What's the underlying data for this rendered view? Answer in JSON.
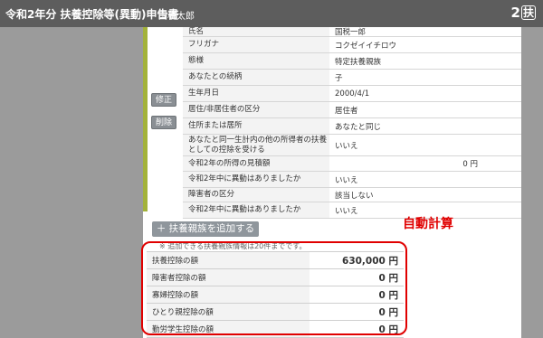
{
  "header": {
    "title": "令和2年分 扶養控除等(異動)申告書",
    "user": "国税太郎",
    "form_no": "2",
    "form_kanji": "扶"
  },
  "side_buttons": {
    "edit": "修正",
    "delete": "削除"
  },
  "details": [
    {
      "label": "氏名",
      "value": "国税一郎"
    },
    {
      "label": "フリガナ",
      "value": "コクゼイイチロウ"
    },
    {
      "label": "態様",
      "value": "特定扶養親族"
    },
    {
      "label": "あなたとの続柄",
      "value": "子"
    },
    {
      "label": "生年月日",
      "value": "2000/4/1"
    },
    {
      "label": "居住/非居住者の区分",
      "value": "居住者"
    },
    {
      "label": "住所または居所",
      "value": "あなたと同じ"
    },
    {
      "label": "あなたと同一生計内の他の所得者の扶養としての控除を受ける",
      "value": "いいえ"
    },
    {
      "label": "令和2年の所得の見積額",
      "value": "0 円"
    },
    {
      "label": "令和2年中に異動はありましたか",
      "value": "いいえ"
    },
    {
      "label": "障害者の区分",
      "value": "該当しない"
    },
    {
      "label": "令和2年中に異動はありましたか",
      "value": "いいえ"
    }
  ],
  "add_button": "＋ 扶養親族を追加する",
  "auto_calc": "自動計算",
  "note": "※ 追加できる扶養親族情報は20件までです。",
  "deductions": [
    {
      "label": "扶養控除の額",
      "value": "630,000 円"
    },
    {
      "label": "障害者控除の額",
      "value": "0 円"
    },
    {
      "label": "寡婦控除の額",
      "value": "0 円"
    },
    {
      "label": "ひとり親控除の額",
      "value": "0 円"
    },
    {
      "label": "勤労学生控除の額",
      "value": "0 円"
    }
  ],
  "colors": {
    "header": "#5d5d5d",
    "accent_bar": "#a3b23a",
    "highlight": "#e00000"
  }
}
